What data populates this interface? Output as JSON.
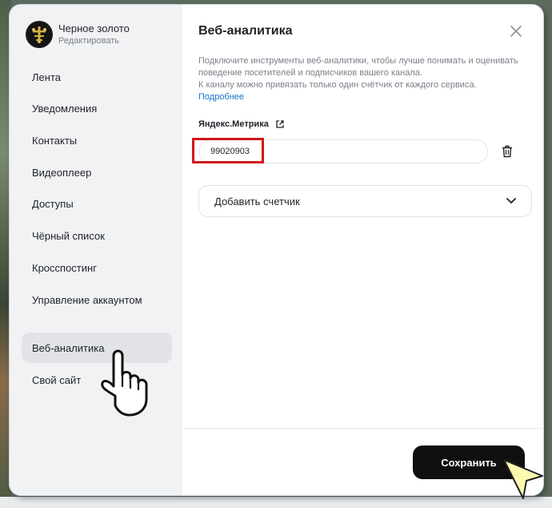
{
  "channel": {
    "name": "Черное золото",
    "edit_label": "Редактировать"
  },
  "sidebar": {
    "items": [
      {
        "label": "Лента",
        "active": false
      },
      {
        "label": "Уведомления",
        "active": false
      },
      {
        "label": "Контакты",
        "active": false
      },
      {
        "label": "Видеоплеер",
        "active": false
      },
      {
        "label": "Доступы",
        "active": false
      },
      {
        "label": "Чёрный список",
        "active": false
      },
      {
        "label": "Кросспостинг",
        "active": false
      },
      {
        "label": "Управление аккаунтом",
        "active": false
      },
      {
        "label": "Веб-аналитика",
        "active": true
      },
      {
        "label": "Свой сайт",
        "active": false
      }
    ]
  },
  "main": {
    "title": "Веб-аналитика",
    "description_line1": "Подключите инструменты веб-аналитики, чтобы лучше понимать и оценивать",
    "description_line2": "поведение посетителей и подписчиков вашего канала.",
    "description_line3": "К каналу можно привязать только один счётчик от каждого сервиса.",
    "more_link": "Подробнее",
    "metrika_label": "Яндекс.Метрика",
    "counter_value": "99020903",
    "add_counter_label": "Добавить счетчик",
    "save_label": "Сохранить"
  },
  "icons": {
    "close": "close-icon",
    "external": "external-link-icon",
    "trash": "trash-icon",
    "chevron": "chevron-down-icon"
  },
  "colors": {
    "accent_link": "#1a73c9",
    "highlight": "#d0161b",
    "save_button": "#0f0f0f"
  }
}
